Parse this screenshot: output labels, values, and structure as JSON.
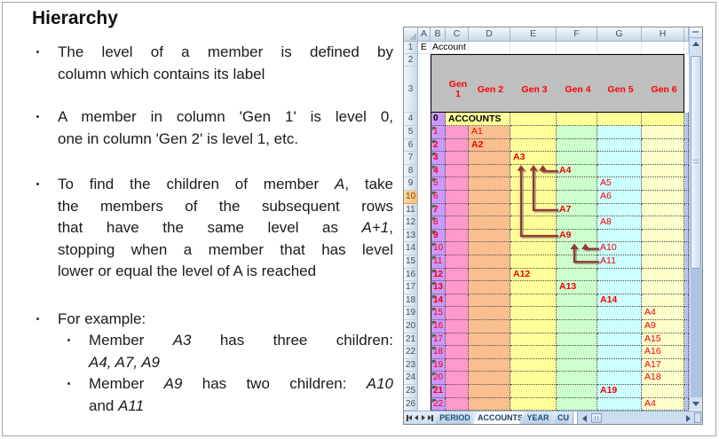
{
  "slide": {
    "title": "Hierarchy",
    "bullets": [
      {
        "lines": [
          {
            "j": true,
            "segs": [
              {
                "t": "The level of a member is defined by"
              }
            ]
          },
          {
            "j": false,
            "segs": [
              {
                "t": "column which contains its label"
              }
            ]
          }
        ]
      },
      {
        "lines": [
          {
            "j": true,
            "segs": [
              {
                "t": "A member in column 'Gen 1' is level 0,"
              }
            ]
          },
          {
            "j": false,
            "segs": [
              {
                "t": "one in column 'Gen 2' is level 1, etc."
              }
            ]
          }
        ]
      },
      {
        "lines": [
          {
            "j": true,
            "segs": [
              {
                "t": "To find the children of member "
              },
              {
                "t": "A",
                "i": true
              },
              {
                "t": ", take"
              }
            ]
          },
          {
            "j": true,
            "segs": [
              {
                "t": "the members of the subsequent rows"
              }
            ]
          },
          {
            "j": true,
            "segs": [
              {
                "t": "that have the same level as "
              },
              {
                "t": "A+1",
                "i": true
              },
              {
                "t": ","
              }
            ]
          },
          {
            "j": true,
            "segs": [
              {
                "t": "stopping when a member that has level"
              }
            ]
          },
          {
            "j": false,
            "segs": [
              {
                "t": "lower or equal the level of A is reached"
              }
            ]
          }
        ]
      },
      {
        "lines": [
          {
            "j": false,
            "segs": [
              {
                "t": "For example:"
              }
            ]
          }
        ],
        "sub": [
          {
            "lines": [
              {
                "j": true,
                "segs": [
                  {
                    "t": "Member "
                  },
                  {
                    "t": "A3",
                    "i": true
                  },
                  {
                    "t": " has three children:"
                  }
                ]
              },
              {
                "j": false,
                "segs": [
                  {
                    "t": "A4, A7, A9",
                    "i": true
                  }
                ]
              }
            ]
          },
          {
            "lines": [
              {
                "j": true,
                "segs": [
                  {
                    "t": "Member "
                  },
                  {
                    "t": "A9",
                    "i": true
                  },
                  {
                    "t": " has two children: "
                  },
                  {
                    "t": "A10",
                    "i": true
                  }
                ]
              },
              {
                "j": false,
                "segs": [
                  {
                    "t": "and "
                  },
                  {
                    "t": "A11",
                    "i": true
                  }
                ]
              }
            ]
          }
        ]
      }
    ]
  },
  "sheet": {
    "column_headers": [
      "A",
      "B",
      "C",
      "D",
      "E",
      "F",
      "G",
      "H"
    ],
    "gen_headers": [
      "Gen 1",
      "Gen 2",
      "Gen 3",
      "Gen 4",
      "Gen 5",
      "Gen 6"
    ],
    "rows": [
      {
        "n": 1,
        "cells": [
          {
            "col": "A",
            "v": "E"
          },
          {
            "col": "B",
            "v": "Account"
          }
        ]
      },
      {
        "n": 2,
        "band": true
      },
      {
        "n": 3,
        "gen": true
      },
      {
        "n": 4,
        "b": "0",
        "label": "ACCOUNTS",
        "labelCol": "C",
        "bold": true
      },
      {
        "n": 5,
        "b": "1",
        "label": "A1",
        "labelCol": "D",
        "bold": false
      },
      {
        "n": 6,
        "b": "2",
        "label": "A2",
        "labelCol": "D",
        "bold": true
      },
      {
        "n": 7,
        "b": "3",
        "label": "A3",
        "labelCol": "E",
        "bold": true
      },
      {
        "n": 8,
        "b": "4",
        "label": "A4",
        "labelCol": "F",
        "bold": true
      },
      {
        "n": 9,
        "b": "5",
        "label": "A5",
        "labelCol": "G",
        "bold": false
      },
      {
        "n": 10,
        "b": "6",
        "label": "A6",
        "labelCol": "G",
        "bold": false,
        "highlight": true
      },
      {
        "n": 11,
        "b": "7",
        "label": "A7",
        "labelCol": "F",
        "bold": true
      },
      {
        "n": 12,
        "b": "8",
        "label": "A8",
        "labelCol": "G",
        "bold": false
      },
      {
        "n": 13,
        "b": "9",
        "label": "A9",
        "labelCol": "F",
        "bold": true
      },
      {
        "n": 14,
        "b": "10",
        "label": "A10",
        "labelCol": "G",
        "bold": false
      },
      {
        "n": 15,
        "b": "11",
        "label": "A11",
        "labelCol": "G",
        "bold": false
      },
      {
        "n": 16,
        "b": "12",
        "label": "A12",
        "labelCol": "E",
        "bold": true
      },
      {
        "n": 17,
        "b": "13",
        "label": "A13",
        "labelCol": "F",
        "bold": true
      },
      {
        "n": 18,
        "b": "14",
        "label": "A14",
        "labelCol": "G",
        "bold": true
      },
      {
        "n": 19,
        "b": "15",
        "label": "A4",
        "labelCol": "H",
        "bold": false
      },
      {
        "n": 20,
        "b": "16",
        "label": "A9",
        "labelCol": "H",
        "bold": false
      },
      {
        "n": 21,
        "b": "17",
        "label": "A15",
        "labelCol": "H",
        "bold": false
      },
      {
        "n": 22,
        "b": "18",
        "label": "A16",
        "labelCol": "H",
        "bold": false
      },
      {
        "n": 23,
        "b": "19",
        "label": "A17",
        "labelCol": "H",
        "bold": false
      },
      {
        "n": 24,
        "b": "20",
        "label": "A18",
        "labelCol": "H",
        "bold": false
      },
      {
        "n": 25,
        "b": "21",
        "label": "A19",
        "labelCol": "G",
        "bold": true
      },
      {
        "n": 26,
        "b": "22",
        "label": "A4",
        "labelCol": "H",
        "bold": false
      }
    ],
    "arrows": [
      {
        "from": "A4",
        "to": "A3"
      },
      {
        "from": "A7",
        "to": "A3"
      },
      {
        "from": "A9",
        "to": "A3"
      },
      {
        "from": "A10",
        "to": "A9"
      },
      {
        "from": "A11",
        "to": "A9"
      }
    ],
    "tab_bar": {
      "tabs": [
        {
          "label": "PERIOD",
          "active": false
        },
        {
          "label": "ACCOUNTS",
          "active": true
        },
        {
          "label": "YEAR",
          "active": false
        },
        {
          "label": "CU",
          "active": false
        }
      ]
    }
  },
  "colors": {
    "col_A": "#FFFFFF",
    "col_B": "#CC99FF",
    "col_C": "#FF99CC",
    "col_D": "#FABF8F",
    "col_E": "#FFFF99",
    "col_F": "#CCFFCC",
    "col_G": "#CCFFFF",
    "col_H": "#FFFFCC",
    "edge_col": "#B9C7E8",
    "row4_fill": "#FFFF99",
    "gen_band": "#BFBFBF",
    "red_text": "#F20000",
    "gen_text": "#FF0000",
    "arrow": "#953735"
  }
}
